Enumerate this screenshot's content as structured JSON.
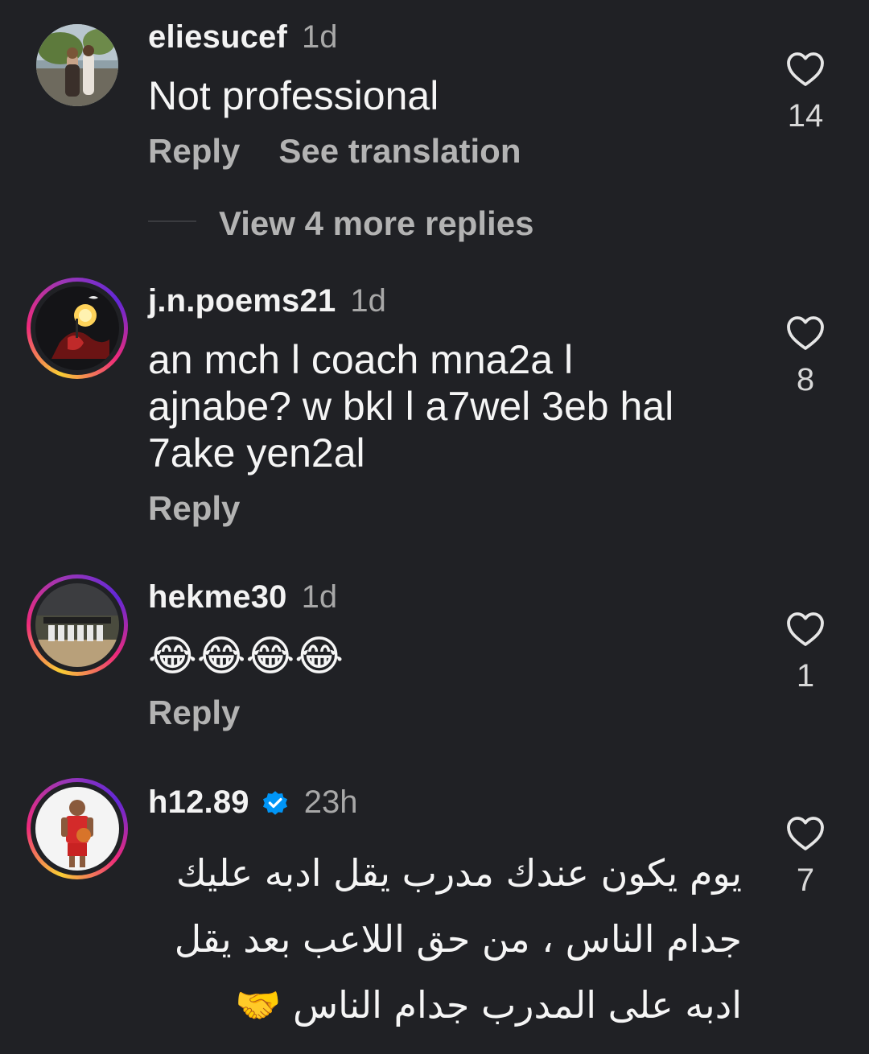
{
  "comments": [
    {
      "username": "eliesucef",
      "time": "1d",
      "text": "Not professional",
      "actions": [
        "Reply",
        "See translation"
      ],
      "likes": "14",
      "avatar": "photo-avatar",
      "story_ring": false
    },
    {
      "username": "j.n.poems21",
      "time": "1d",
      "text_lines": [
        "an mch l coach mna2a l",
        "ajnabe? w bkl l a7wel 3eb hal",
        "7ake yen2al"
      ],
      "actions": [
        "Reply"
      ],
      "likes": "8",
      "avatar": "dark-art-avatar",
      "story_ring": true
    },
    {
      "username": "hekme30",
      "time": "1d",
      "text": "😂😂😂😂",
      "actions": [
        "Reply"
      ],
      "likes": "1",
      "avatar": "team-photo-avatar",
      "story_ring": true
    },
    {
      "username": "h12.89",
      "time": "23h",
      "verified": true,
      "text_lines": [
        "يوم يكون عندك مدرب يقل ادبه عليك",
        "جدام الناس ، من حق اللاعب بعد يقل",
        "ادبه على المدرب جدام الناس 🤝"
      ],
      "likes": "7",
      "avatar": "player-avatar",
      "story_ring": true
    }
  ],
  "view_more_replies": "View 4 more replies",
  "icons": {
    "like": "heart-outline-icon",
    "verified": "verified-badge-icon"
  },
  "colors": {
    "background": "#202125",
    "verified": "#0095f6",
    "muted": "#a8a8a8"
  }
}
